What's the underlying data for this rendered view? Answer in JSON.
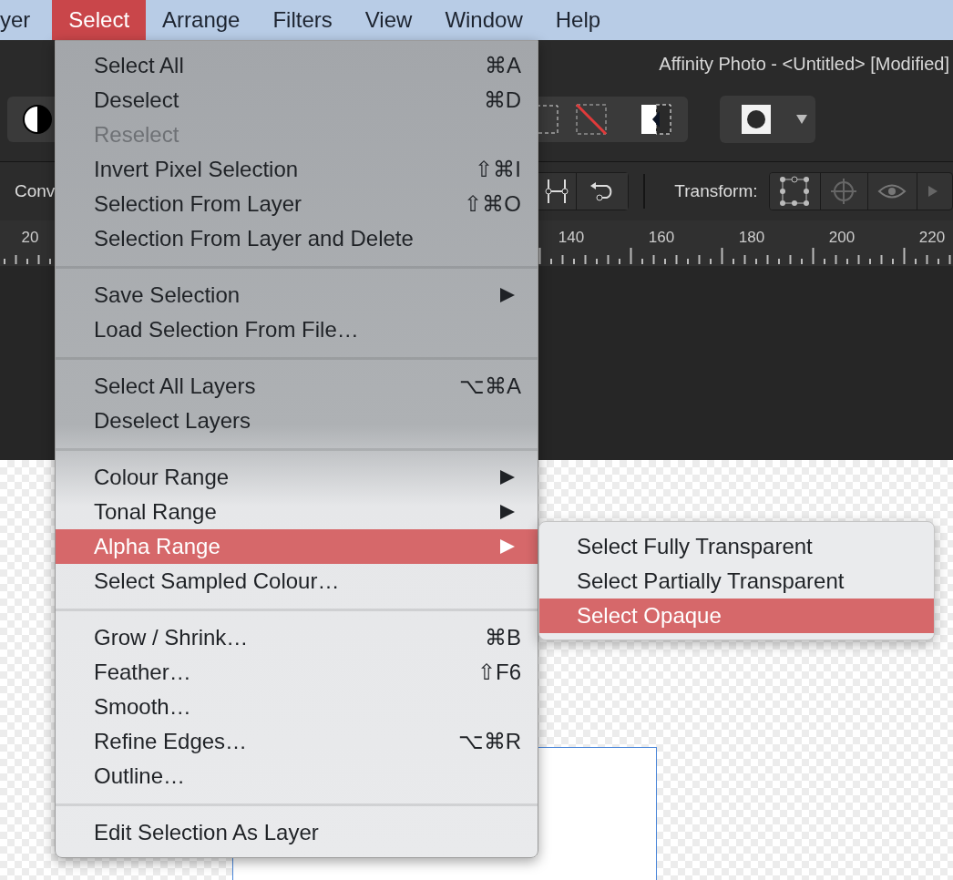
{
  "menubar": [
    {
      "label": "yer",
      "selected": false
    },
    {
      "label": "Select",
      "selected": true
    },
    {
      "label": "Arrange",
      "selected": false
    },
    {
      "label": "Filters",
      "selected": false
    },
    {
      "label": "View",
      "selected": false
    },
    {
      "label": "Window",
      "selected": false
    },
    {
      "label": "Help",
      "selected": false
    }
  ],
  "window": {
    "title": "Affinity Photo - <Untitled> [Modified]"
  },
  "context_toolbar": {
    "label": "Conv",
    "transform_label": "Transform:"
  },
  "ruler": {
    "labels": [
      "20",
      "140",
      "160",
      "180",
      "200",
      "220"
    ]
  },
  "menu": {
    "groups": [
      [
        {
          "label": "Select All",
          "shortcut": "⌘A",
          "kind": "command",
          "disabled": false,
          "selected": false
        },
        {
          "label": "Deselect",
          "shortcut": "⌘D",
          "kind": "command",
          "disabled": false,
          "selected": false
        },
        {
          "label": "Reselect",
          "kind": "command",
          "disabled": true,
          "selected": false
        },
        {
          "label": "Invert Pixel Selection",
          "shortcut": "⇧⌘I",
          "kind": "command",
          "disabled": false,
          "selected": false
        },
        {
          "label": "Selection From Layer",
          "shortcut": "⇧⌘O",
          "kind": "command",
          "disabled": false,
          "selected": false
        },
        {
          "label": "Selection From Layer and Delete",
          "kind": "command",
          "disabled": false,
          "selected": false
        }
      ],
      [
        {
          "label": "Save Selection",
          "kind": "submenu",
          "disabled": false,
          "selected": false
        },
        {
          "label": "Load Selection From File…",
          "kind": "command",
          "disabled": false,
          "selected": false
        }
      ],
      [
        {
          "label": "Select All Layers",
          "shortcut": "⌥⌘A",
          "kind": "command",
          "disabled": false,
          "selected": false
        },
        {
          "label": "Deselect Layers",
          "kind": "command",
          "disabled": false,
          "selected": false
        }
      ],
      [
        {
          "label": "Colour Range",
          "kind": "submenu",
          "disabled": false,
          "selected": false
        },
        {
          "label": "Tonal Range",
          "kind": "submenu",
          "disabled": false,
          "selected": false
        },
        {
          "label": "Alpha Range",
          "kind": "submenu",
          "disabled": false,
          "selected": true
        },
        {
          "label": "Select Sampled Colour…",
          "kind": "command",
          "disabled": false,
          "selected": false
        }
      ],
      [
        {
          "label": "Grow / Shrink…",
          "shortcut": "⌘B",
          "kind": "command",
          "disabled": false,
          "selected": false
        },
        {
          "label": "Feather…",
          "shortcut": "⇧F6",
          "kind": "command",
          "disabled": false,
          "selected": false
        },
        {
          "label": "Smooth…",
          "kind": "command",
          "disabled": false,
          "selected": false
        },
        {
          "label": "Refine Edges…",
          "shortcut": "⌥⌘R",
          "kind": "command",
          "disabled": false,
          "selected": false
        },
        {
          "label": "Outline…",
          "kind": "command",
          "disabled": false,
          "selected": false
        }
      ],
      [
        {
          "label": "Edit Selection As Layer",
          "kind": "command",
          "disabled": false,
          "selected": false
        }
      ]
    ]
  },
  "submenu": {
    "items": [
      {
        "label": "Select Fully Transparent",
        "selected": false
      },
      {
        "label": "Select Partially Transparent",
        "selected": false
      },
      {
        "label": "Select Opaque",
        "selected": true
      }
    ]
  }
}
